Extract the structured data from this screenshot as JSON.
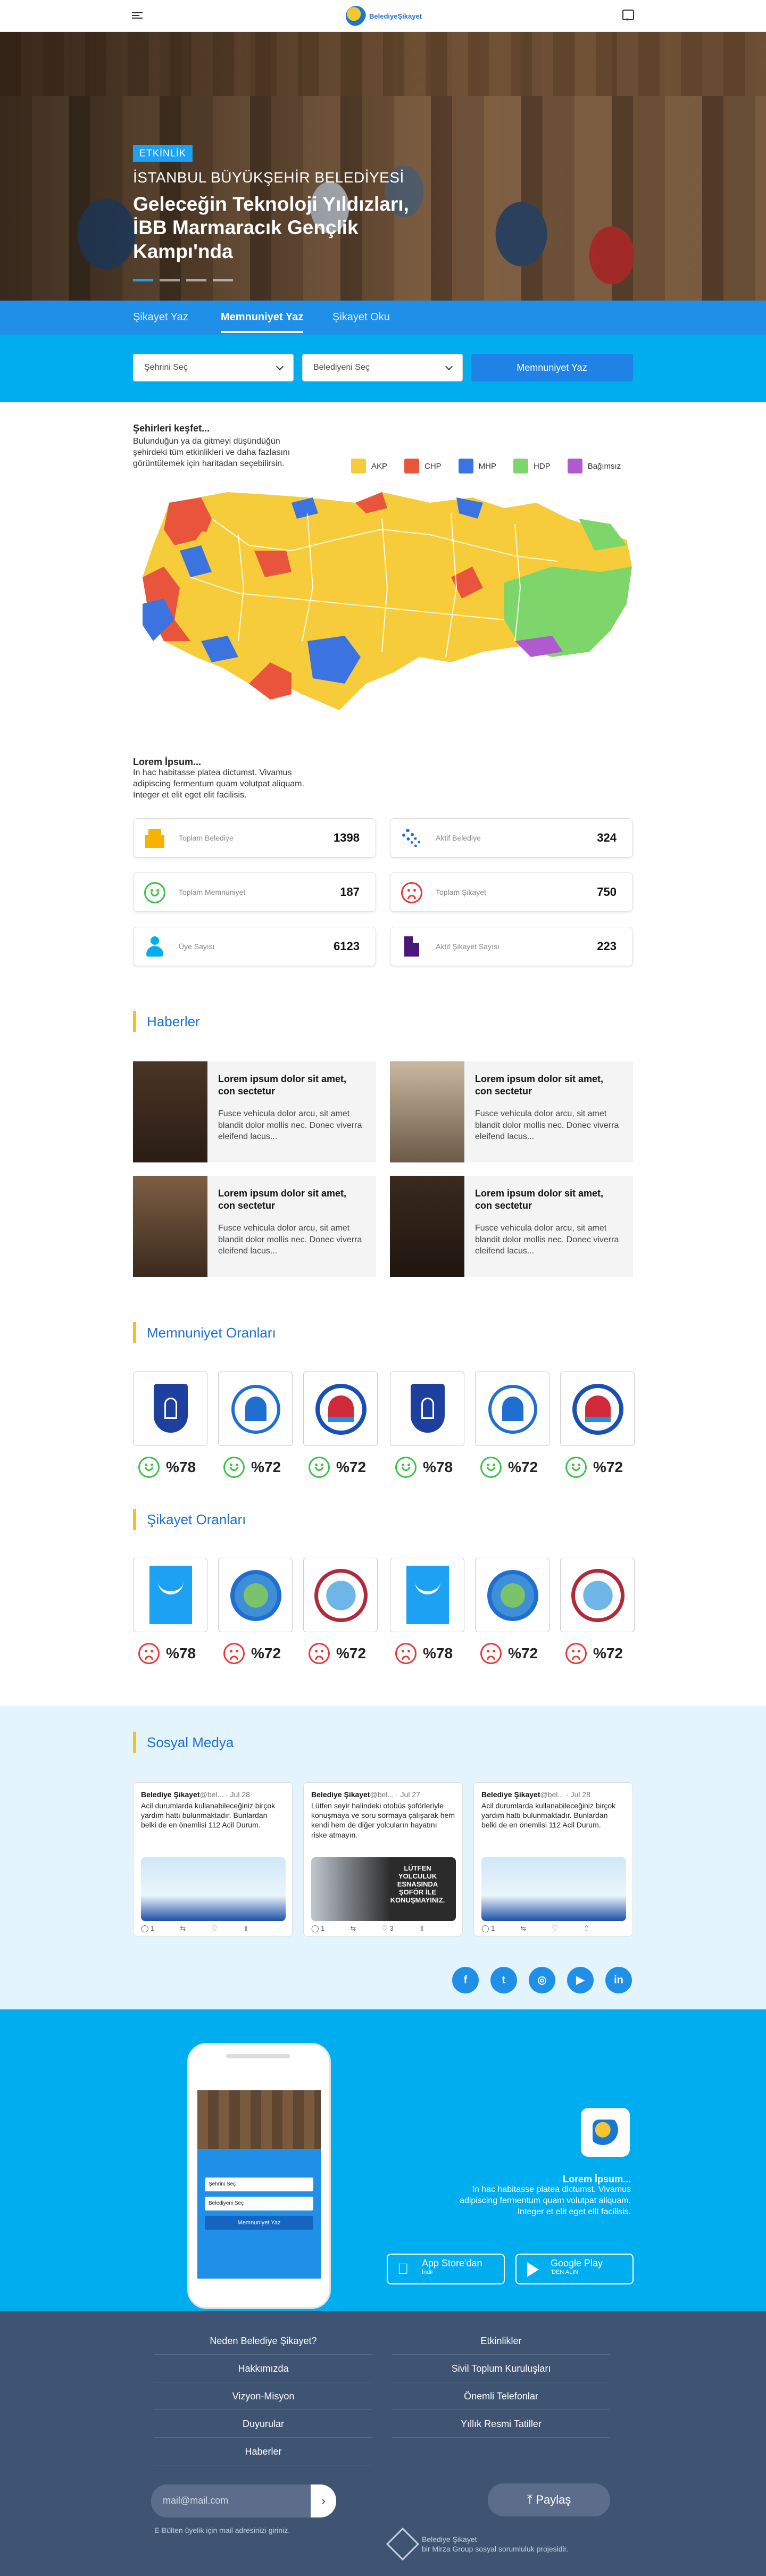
{
  "header": {
    "logo_text": "BelediyeŞikayet"
  },
  "hero": {
    "badge": "ETKİNLİK",
    "subtitle": "İSTANBUL BÜYÜKŞEHİR BELEDİYESİ",
    "title": "Geleceğin Teknoloji Yıldızları, İBB Marmaracık Gençlik Kampı'nda"
  },
  "tabs": [
    {
      "label": "Şikayet Yaz"
    },
    {
      "label": "Memnuniyet Yaz",
      "active": true
    },
    {
      "label": "Şikayet Oku"
    }
  ],
  "selectors": {
    "city": "Şehrini Seç",
    "municipality": "Belediyeni Seç",
    "button": "Memnuniyet Yaz"
  },
  "map": {
    "title": "Şehirleri keşfet...",
    "description": "Bulunduğun ya da gitmeyi düşündüğün şehirdeki tüm etkinlikleri ve daha fazlasını görüntülemek için haritadan seçebilirsin.",
    "legend": [
      {
        "label": "AKP",
        "color": "#f7cc3a"
      },
      {
        "label": "CHP",
        "color": "#e8553c"
      },
      {
        "label": "MHP",
        "color": "#3b73e0"
      },
      {
        "label": "HDP",
        "color": "#7ed66b"
      },
      {
        "label": "Bağımsız",
        "color": "#b05ad2"
      }
    ]
  },
  "lorem": {
    "title": "Lorem İpsum...",
    "description": "In hac habitasse platea dictumst. Vivamus adipiscing fermentum quam volutpat aliquam. Integer et elit eget elit facilisis."
  },
  "stats": [
    {
      "label": "Toplam Belediye",
      "value": "1398",
      "icon": "building-icon",
      "color": "#f5b400"
    },
    {
      "label": "Aktif Belediye",
      "value": "324",
      "icon": "gears-icon",
      "color": "#1f6fd1"
    },
    {
      "label": "Toplam Memnuniyet",
      "value": "187",
      "icon": "happy-face-icon",
      "color": "#3cc14a"
    },
    {
      "label": "Toplam Şikayet",
      "value": "750",
      "icon": "sad-face-icon",
      "color": "#e6393a"
    },
    {
      "label": "Üye Sayısı",
      "value": "6123",
      "icon": "user-icon",
      "color": "#00aeef"
    },
    {
      "label": "Aktif Şikayet Sayısı",
      "value": "223",
      "icon": "document-icon",
      "color": "#4a1678"
    }
  ],
  "news": {
    "title": "Haberler",
    "items": [
      {
        "title": "Lorem ipsum dolor sit amet, con sectetur",
        "text": "Fusce vehicula dolor arcu, sit amet blandit dolor mollis nec. Donec viverra eleifend lacus..."
      },
      {
        "title": "Lorem ipsum dolor sit amet, con sectetur",
        "text": "Fusce vehicula dolor arcu, sit amet blandit dolor mollis nec. Donec viverra eleifend lacus..."
      },
      {
        "title": "Lorem ipsum dolor sit amet, con sectetur",
        "text": "Fusce vehicula dolor arcu, sit amet blandit dolor mollis nec. Donec viverra eleifend lacus..."
      },
      {
        "title": "Lorem ipsum dolor sit amet, con sectetur",
        "text": "Fusce vehicula dolor arcu, sit amet blandit dolor mollis nec. Donec viverra eleifend lacus..."
      }
    ]
  },
  "satisfaction": {
    "title": "Memnuniyet Oranları",
    "items": [
      {
        "rate": "%78",
        "logo": "ankara-logo"
      },
      {
        "rate": "%72",
        "logo": "ibb-logo"
      },
      {
        "rate": "%72",
        "logo": "mersin-logo"
      },
      {
        "rate": "%78",
        "logo": "ankara-logo"
      },
      {
        "rate": "%72",
        "logo": "ibb-logo"
      },
      {
        "rate": "%72",
        "logo": "mersin-logo"
      }
    ]
  },
  "complaints": {
    "title": "Şikayet Oranları",
    "items": [
      {
        "rate": "%78",
        "logo": "aliaga-logo"
      },
      {
        "rate": "%72",
        "logo": "round-municipality-logo"
      },
      {
        "rate": "%72",
        "logo": "dilovasi-logo"
      },
      {
        "rate": "%78",
        "logo": "aliaga-logo"
      },
      {
        "rate": "%72",
        "logo": "round-municipality-logo"
      },
      {
        "rate": "%72",
        "logo": "dilovasi-logo"
      }
    ]
  },
  "social": {
    "title": "Sosyal Medya",
    "tweets": [
      {
        "name": "Belediye Şikayet",
        "handle": "@bel...",
        "date": "Jul 28",
        "text": "Acil durumlarda kullanabileceğiniz birçok yardım hattı bulunmaktadır. Bunlardan belki de en önemlisi 112 Acil Durum.",
        "replies": "1",
        "likes": ""
      },
      {
        "name": "Belediye Şikayet",
        "handle": "@bel...",
        "date": "Jul 27",
        "text": "Lütfen seyir halindeki otobüs şoförleriyle konuşmaya ve soru sormaya çalışarak hem kendi hem de diğer yolcuların hayatını riske atmayın.",
        "replies": "1",
        "likes": "3",
        "image_text": "LÜTFEN YOLCULUK ESNASINDA ŞOFÖR İLE KONUŞMAYINIZ."
      },
      {
        "name": "Belediye Şikayet",
        "handle": "@bel...",
        "date": "Jul 28",
        "text": "Acil durumlarda kullanabileceğiniz birçok yardım hattı bulunmaktadır. Bunlardan belki de en önemlisi 112 Acil Durum.",
        "replies": "1",
        "likes": ""
      }
    ],
    "icons": [
      "facebook-icon",
      "twitter-icon",
      "instagram-icon",
      "youtube-icon",
      "linkedin-icon"
    ]
  },
  "app": {
    "title": "Lorem İpsum...",
    "description": "In hac habitasse platea dictumst. Vivamus adipiscing fermentum quam volutpat aliquam. Integer et elit eget elit facilisis.",
    "appstore": {
      "label": "App Store'dan",
      "small": "İndir"
    },
    "googleplay": {
      "label": "Google Play",
      "small": "'DEN ALIN"
    }
  },
  "footer": {
    "left": [
      "Neden Belediye Şikayet?",
      "Hakkımızda",
      "Vizyon-Misyon",
      "Duyurular",
      "Haberler"
    ],
    "right": [
      "Etkinlikler",
      "Sivil Toplum Kuruluşları",
      "Önemli Telefonlar",
      "Yıllık Resmi Tatiller"
    ],
    "email_placeholder": "mail@mail.com",
    "email_note": "E-Bülten üyelik için mail adresinizi  giriniz.",
    "share": "Paylaş",
    "brand_line1": "Belediye Şikayet",
    "brand_line2": "bir Mirza Group sosyal sorumluluk projesidir."
  }
}
